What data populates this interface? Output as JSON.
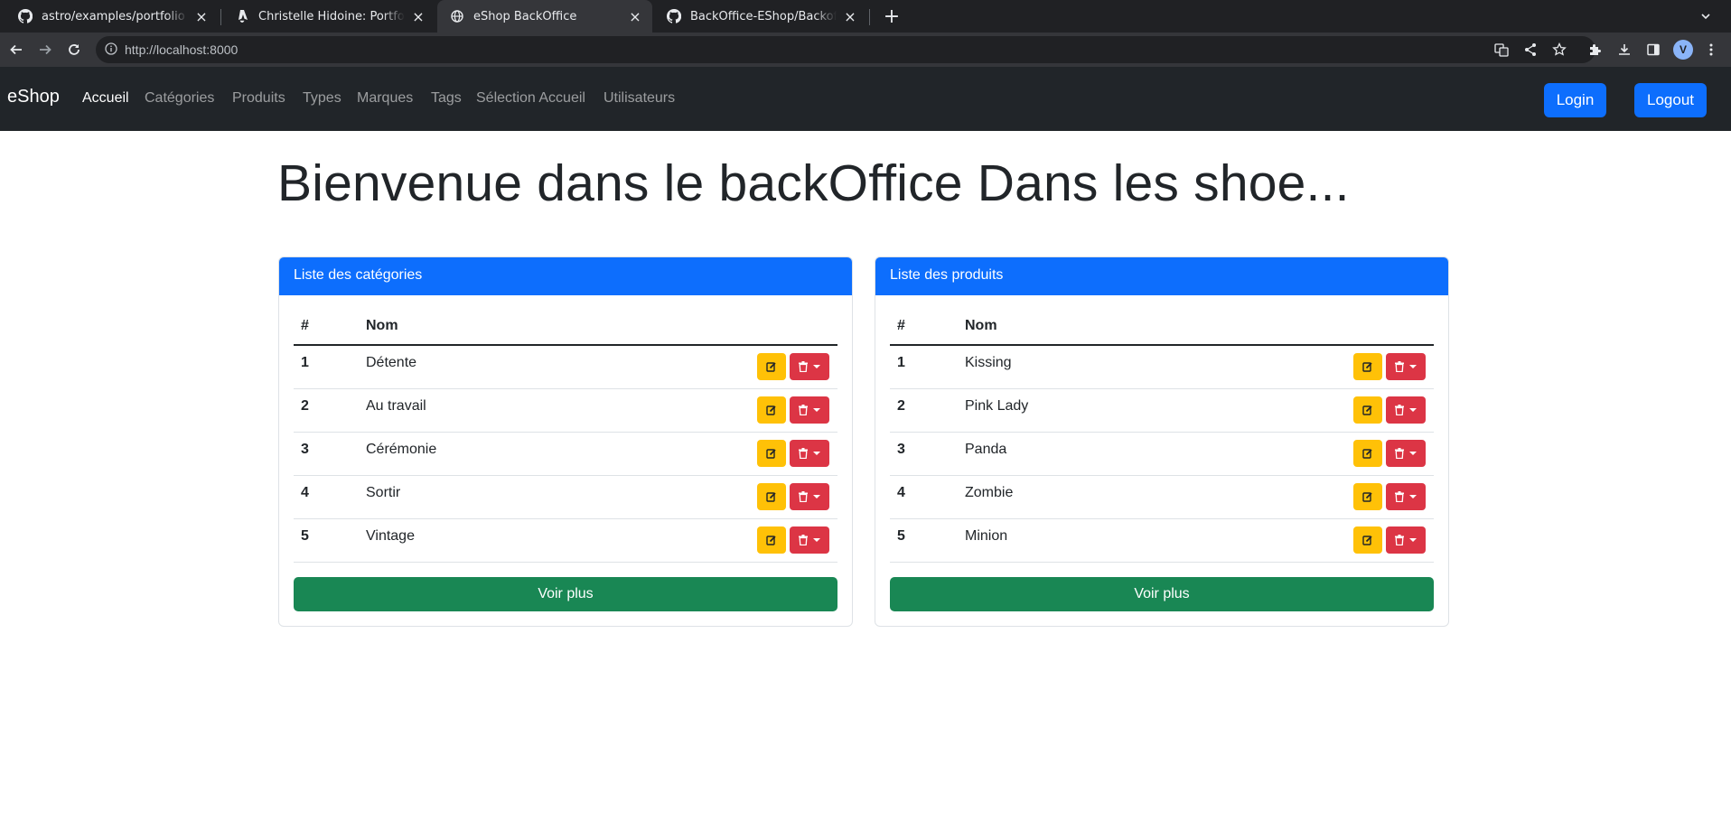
{
  "browser": {
    "tabs": [
      {
        "title": "astro/examples/portfolio at main",
        "icon": "github-icon",
        "active": false
      },
      {
        "title": "Christelle Hidoine: Portfolio",
        "icon": "astro-icon",
        "active": false
      },
      {
        "title": "eShop BackOffice",
        "icon": "globe-icon",
        "active": true
      },
      {
        "title": "BackOffice-EShop/Backoffice-HTML",
        "icon": "github-icon",
        "active": false
      }
    ],
    "url": "http://localhost:8000",
    "avatar_initial": "V"
  },
  "navbar": {
    "brand": "eShop",
    "links": [
      "Accueil",
      "Catégories",
      "Produits",
      "Types",
      "Marques",
      "Tags",
      "Sélection Accueil",
      "Utilisateurs"
    ],
    "active_link": "Accueil",
    "login_label": "Login",
    "logout_label": "Logout"
  },
  "main": {
    "title": "Bienvenue dans le backOffice Dans les shoe...",
    "categories_card": {
      "header": "Liste des catégories",
      "col_num": "#",
      "col_name": "Nom",
      "rows": [
        {
          "num": "1",
          "name": "Détente"
        },
        {
          "num": "2",
          "name": "Au travail"
        },
        {
          "num": "3",
          "name": "Cérémonie"
        },
        {
          "num": "4",
          "name": "Sortir"
        },
        {
          "num": "5",
          "name": "Vintage"
        }
      ],
      "more_label": "Voir plus"
    },
    "products_card": {
      "header": "Liste des produits",
      "col_num": "#",
      "col_name": "Nom",
      "rows": [
        {
          "num": "1",
          "name": "Kissing"
        },
        {
          "num": "2",
          "name": "Pink Lady"
        },
        {
          "num": "3",
          "name": "Panda"
        },
        {
          "num": "4",
          "name": "Zombie"
        },
        {
          "num": "5",
          "name": "Minion"
        }
      ],
      "more_label": "Voir plus"
    }
  },
  "colors": {
    "primary": "#0d6efd",
    "warning": "#ffc107",
    "danger": "#dc3545",
    "success": "#198754",
    "navbar": "#212529"
  }
}
